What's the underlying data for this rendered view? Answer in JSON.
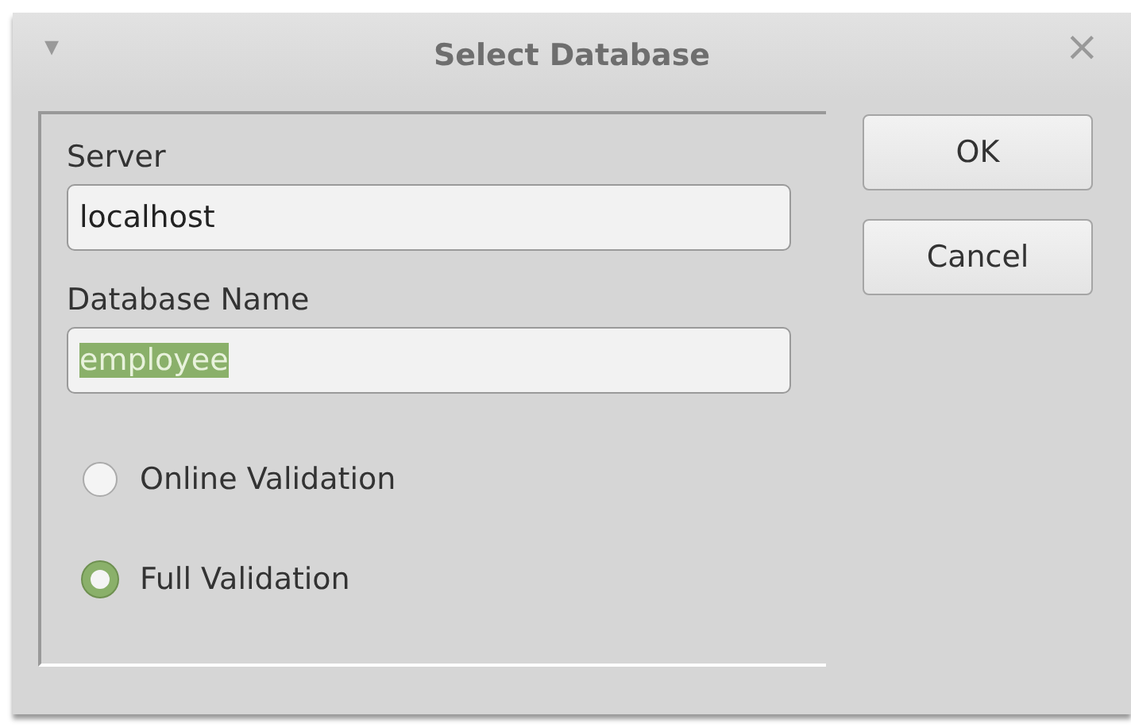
{
  "window": {
    "title": "Select Database",
    "menu_glyph": "▾",
    "close_glyph": "×"
  },
  "fields": [
    {
      "label": "Server",
      "value": "localhost",
      "selected_text": false
    },
    {
      "label": "Database Name",
      "value": "employee",
      "selected_text": true
    }
  ],
  "options": [
    {
      "label": "Online Validation",
      "selected": false
    },
    {
      "label": "Full Validation",
      "selected": true
    }
  ],
  "buttons": [
    "OK",
    "Cancel"
  ]
}
